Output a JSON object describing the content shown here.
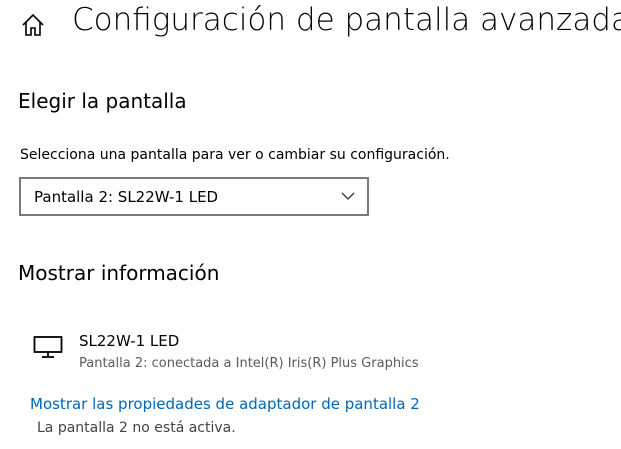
{
  "header": {
    "home_icon": "home-icon",
    "title": "Configuración de pantalla avanzada"
  },
  "choose_display": {
    "heading": "Elegir la pantalla",
    "instruction": "Selecciona una pantalla para ver o cambiar su configuración.",
    "selected_value": "Pantalla 2: SL22W-1 LED",
    "dropdown_icon": "chevron-down-icon"
  },
  "display_info": {
    "heading": "Mostrar información",
    "monitor_icon": "monitor-icon",
    "display_name": "SL22W-1 LED",
    "display_subtitle": "Pantalla 2: conectada a Intel(R) Iris(R) Plus Graphics",
    "adapter_link": "Mostrar las propiedades de adaptador de pantalla 2",
    "inactive_note": "La pantalla 2 no está activa."
  },
  "colors": {
    "link": "#0067b8",
    "secondary_text": "#5a5a5a",
    "select_border": "#7a7a7a"
  }
}
